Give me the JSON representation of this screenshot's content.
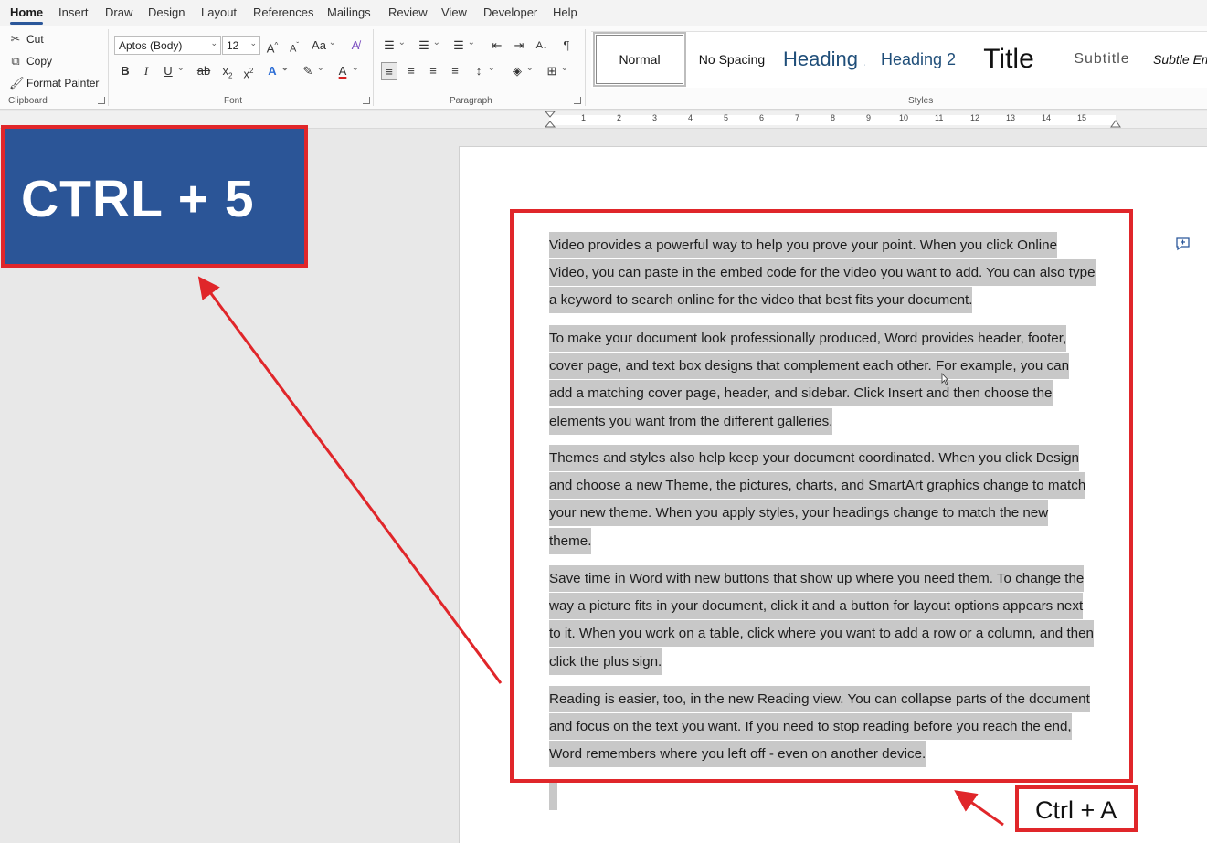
{
  "menu": {
    "tabs": [
      "Home",
      "Insert",
      "Draw",
      "Design",
      "Layout",
      "References",
      "Mailings",
      "Review",
      "View",
      "Developer",
      "Help"
    ],
    "active": "Home"
  },
  "clipboard": {
    "cut": "Cut",
    "copy": "Copy",
    "format_painter": "Format Painter",
    "label": "Clipboard"
  },
  "font": {
    "name": "Aptos (Body)",
    "size": "12",
    "label": "Font"
  },
  "paragraph": {
    "label": "Paragraph"
  },
  "styles": {
    "label": "Styles",
    "items": [
      "Normal",
      "No Spacing",
      "Heading 1",
      "Heading 2",
      "Title",
      "Subtitle",
      "Subtle Em"
    ]
  },
  "ruler": {
    "numbers": [
      "1",
      "2",
      "3",
      "4",
      "5",
      "6",
      "7",
      "8",
      "9",
      "10",
      "11",
      "12",
      "13",
      "14",
      "15"
    ]
  },
  "document": {
    "paragraphs": [
      [
        "Video provides a powerful way to help you prove your point. When you click Online",
        "Video, you can paste in the embed code for the video you want to add. You can also type",
        "a keyword to search online for the video that best fits your document."
      ],
      [
        "To make your document look professionally produced, Word provides header, footer,",
        "cover page, and text box designs that complement each other. For example, you can",
        "add a matching cover page, header, and sidebar. Click Insert and then choose the",
        "elements you want from the different galleries."
      ],
      [
        "Themes and styles also help keep your document coordinated. When you click Design",
        "and choose a new Theme, the pictures, charts, and SmartArt graphics change to match",
        "your new theme. When you apply styles, your headings change to match the new",
        "theme."
      ],
      [
        "Save time in Word with new buttons that show up where you need them. To change the",
        "way a picture fits in your document, click it and a button for layout options appears next",
        "to it. When you work on a table, click where you want to add a row or a column, and then",
        "click the plus sign."
      ],
      [
        "Reading is easier, too, in the new Reading view. You can collapse parts of the document",
        "and focus on the text you want. If you need to stop reading before you reach the end,",
        "Word remembers where you left off - even on another device."
      ]
    ]
  },
  "annotations": {
    "shortcut_left": "CTRL + 5",
    "shortcut_right": "Ctrl + A",
    "accent": "#e0262a",
    "callout_bg": "#2b5597",
    "selection": "#c8c8c8"
  }
}
